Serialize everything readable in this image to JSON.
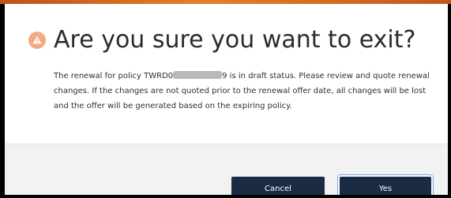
{
  "dialog": {
    "title": "Are you sure you want to exit?",
    "icon": "warning-icon",
    "body": {
      "before_redaction": "The renewal for policy TWRD0",
      "after_redaction": "9 is in draft status. Please review and quote renewal changes. If the changes are not quoted prior to the renewal offer date, all changes will be lost and the offer will be generated based on the expiring policy."
    },
    "buttons": {
      "cancel_label": "Cancel",
      "yes_label": "Yes"
    }
  },
  "colors": {
    "accent_strip": "#e3802c",
    "warning_icon_bg": "#f3a982",
    "button_bg": "#1a2b45",
    "footer_bg": "#f2f2f2"
  }
}
